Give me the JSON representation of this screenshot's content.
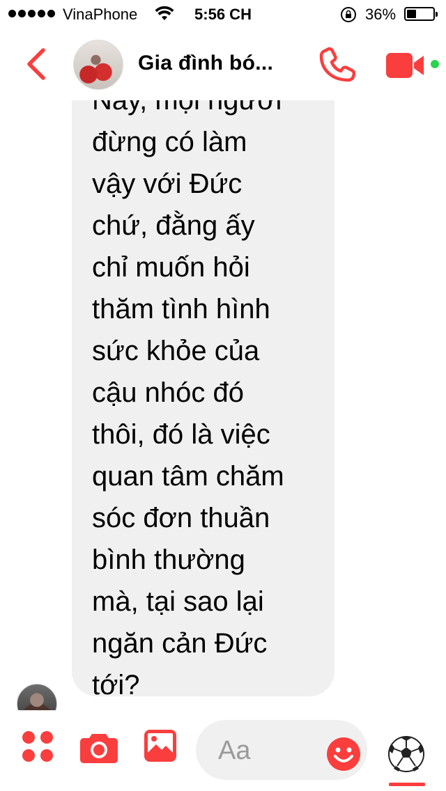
{
  "status_bar": {
    "carrier": "VinaPhone",
    "time": "5:56 CH",
    "battery_percent": "36%",
    "battery_level": 0.36,
    "signal_bars": 5
  },
  "header": {
    "title": "Gia đình bó...",
    "back_icon": "chevron-left-icon",
    "call_icon": "phone-icon",
    "video_icon": "video-camera-icon",
    "accent_color": "#fa3e3e",
    "active_color": "#2bd34f"
  },
  "conversation": {
    "message_text": "Này, mọi người\nđừng có làm\nvậy với Đức\nchứ, đằng ấy\nchỉ muốn hỏi\nthăm tình hình\nsức khỏe của\ncậu nhóc đó\nthôi, đó là việc\nquan tâm chăm\nsóc đơn thuần\nbình thường\nmà, tại sao lại\nngăn cản Đức\ntới?",
    "bubble_color": "#f1f0f0"
  },
  "composer": {
    "placeholder": "Aa",
    "apps_icon": "apps-grid-icon",
    "camera_icon": "camera-icon",
    "gallery_icon": "image-icon",
    "emoji_icon": "smiley-icon",
    "reaction_icon": "soccer-ball-icon"
  }
}
